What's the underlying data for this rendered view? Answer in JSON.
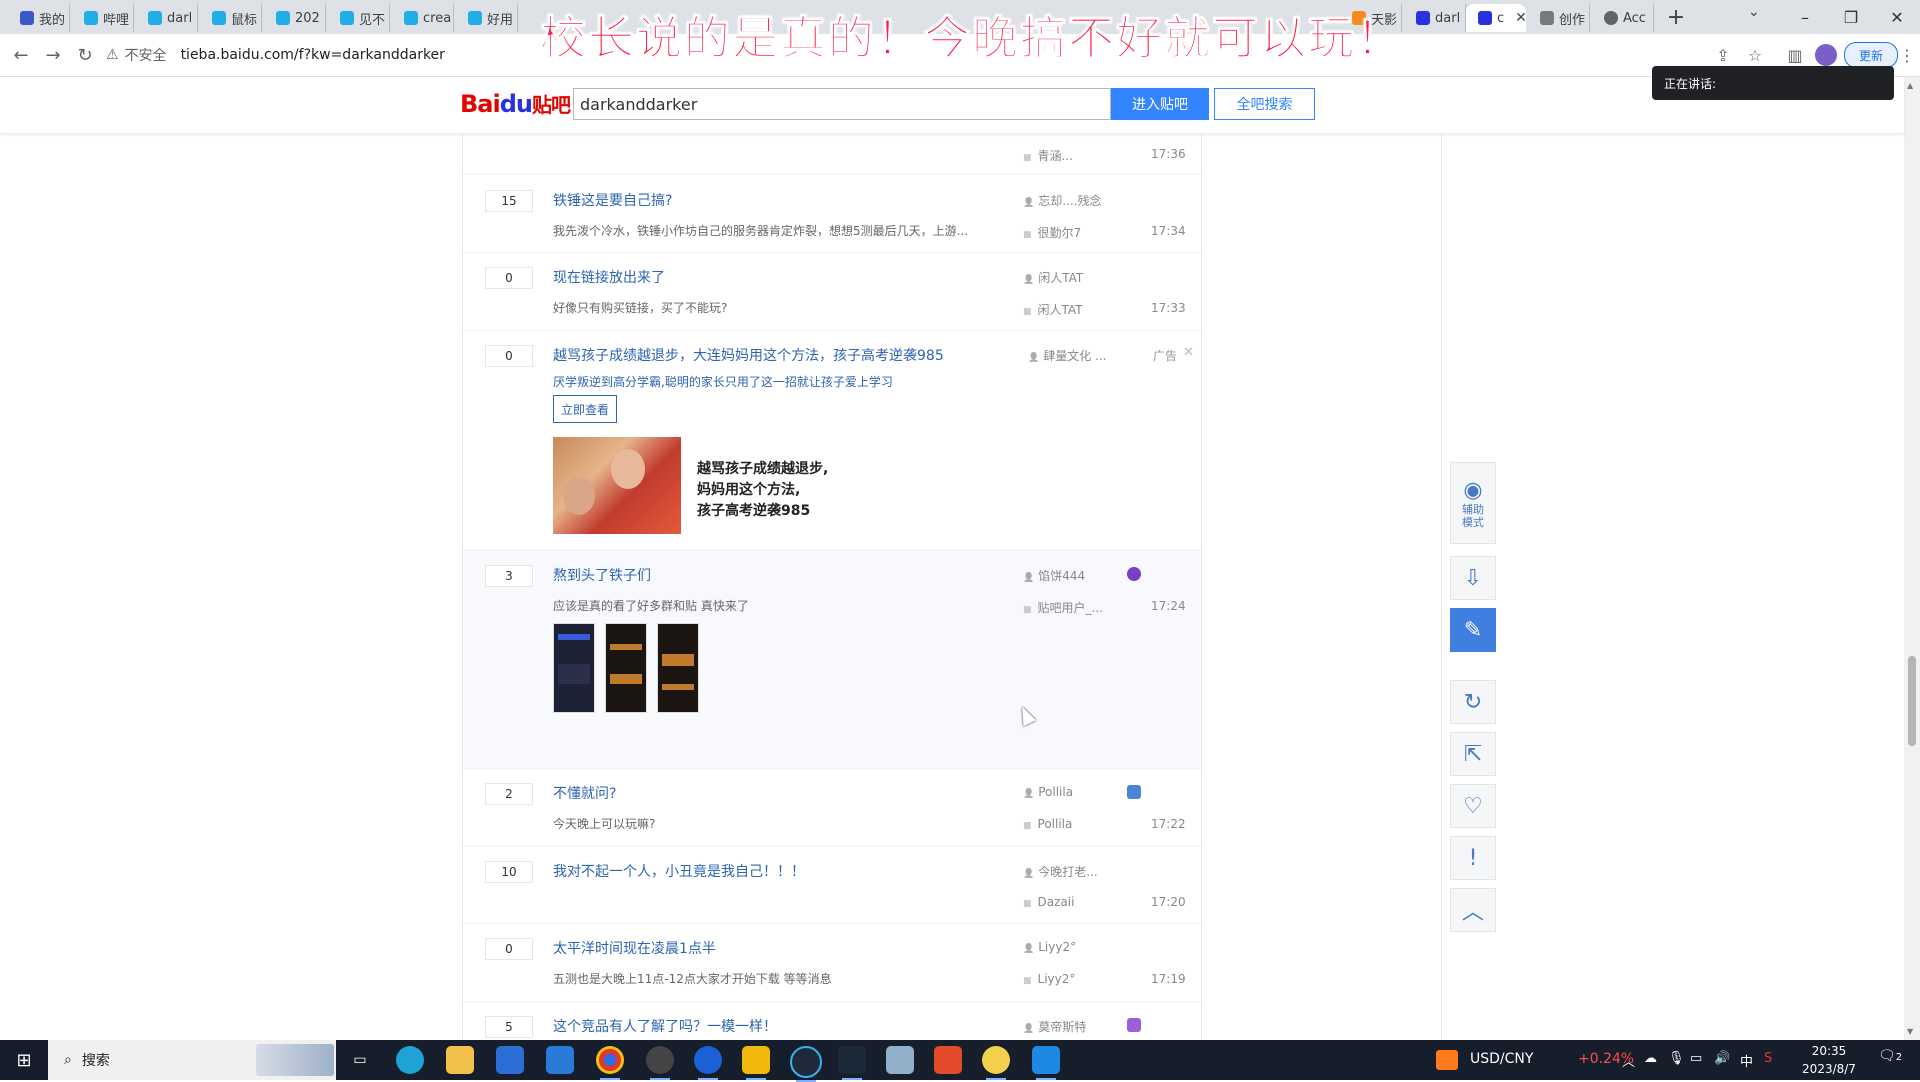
{
  "overlay_banner": "校长说的是真的！今晚搞不好就可以玩！",
  "tabs": [
    {
      "label": "我的"
    },
    {
      "label": "哔哩"
    },
    {
      "label": "darl"
    },
    {
      "label": "鼠标"
    },
    {
      "label": "202"
    },
    {
      "label": "见不"
    },
    {
      "label": "crea"
    },
    {
      "label": "好用"
    },
    {
      "label": "天影"
    },
    {
      "label": "darl"
    },
    {
      "label": "c"
    },
    {
      "label": "创作"
    },
    {
      "label": "Acc"
    }
  ],
  "toolbar": {
    "insecure_label": "不安全",
    "url": "tieba.baidu.com/f?kw=darkanddarker",
    "update_label": "更新"
  },
  "speaking_popup": "正在讲话:",
  "tieba": {
    "logo_text": "Bai",
    "logo_paw": "du",
    "logo_suffix": "贴吧",
    "search_value": "darkanddarker",
    "enter_button": "进入贴吧",
    "all_search_button": "全吧搜索"
  },
  "threads": [
    {
      "replies": "",
      "title": "",
      "abstract": "",
      "author": "",
      "last_reply": "青涵...",
      "time": "17:36"
    },
    {
      "replies": "15",
      "title": "铁锤这是要自己搞?",
      "abstract": "我先泼个冷水，铁锤小作坊自己的服务器肯定炸裂，想想5测最后几天，上游...",
      "author": "忘却....残念",
      "last_reply": "很勤尔7",
      "time": "17:34"
    },
    {
      "replies": "0",
      "title": "现在链接放出来了",
      "abstract": "好像只有购买链接，买了不能玩?",
      "author": "闲人TAT",
      "last_reply": "闲人TAT",
      "time": "17:33"
    },
    {
      "replies": "3",
      "title": "熬到头了铁子们",
      "abstract": "应该是真的看了好多群和贴 真快来了",
      "author": "馅饼444",
      "last_reply": "贴吧用户_...",
      "time": "17:24"
    },
    {
      "replies": "2",
      "title": "不懂就问?",
      "abstract": "今天晚上可以玩嘛?",
      "author": "Pollila",
      "last_reply": "Pollila",
      "time": "17:22"
    },
    {
      "replies": "10",
      "title": "我对不起一个人，小丑竟是我自己！！！",
      "abstract": "",
      "author": "今晚打老...",
      "last_reply": "Dazaii",
      "time": "17:20"
    },
    {
      "replies": "0",
      "title": "太平洋时间现在凌晨1点半",
      "abstract": "五测也是大晚上11点-12点大家才开始下载 等等消息",
      "author": "Liyy2°",
      "last_reply": "Liyy2°",
      "time": "17:19"
    },
    {
      "replies": "5",
      "title": "这个竞品有人了解了吗？一模一样！",
      "abstract": "",
      "author": "莫帝斯特",
      "last_reply": "",
      "time": ""
    }
  ],
  "ad": {
    "replies": "0",
    "title": "越骂孩子成绩越退步，大连妈妈用这个方法，孩子高考逆袭985",
    "subtitle": "厌学叛逆到高分学霸,聪明的家长只用了这一招就让孩子爱上学习",
    "cta": "立即查看",
    "author": "肆量文化 ...",
    "tag": "广告",
    "image_text": [
      "越骂孩子成绩越退步,",
      "妈妈用这个方法,",
      "孩子高考逆袭985"
    ]
  },
  "side_tools": {
    "assist_label": "辅助模式"
  },
  "taskbar": {
    "search_label": "搜索",
    "fx_label": "USD/CNY",
    "fx_change": "+0.24%",
    "ime": "中",
    "time": "20:35",
    "date": "2023/8/7",
    "notifications": "2"
  },
  "colors": {
    "banner": "#ff1e48",
    "link": "#2d64b3",
    "primary_button": "#3385ff",
    "fx_change": "#ff4d4f"
  }
}
